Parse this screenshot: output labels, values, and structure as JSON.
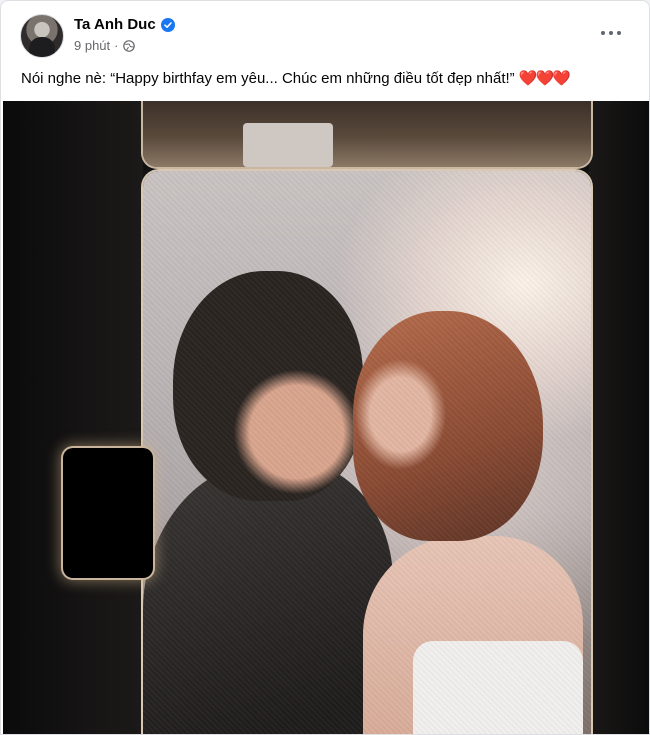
{
  "post": {
    "author_name": "Ta Anh Duc",
    "time": "9 phút",
    "separator": "·",
    "caption_text": "Nói nghe nè: “Happy birthfay em yêu... Chúc em những điều tốt đẹp nhất!”",
    "caption_emoji": "❤️❤️❤️"
  },
  "icons": {
    "verified": "verified-badge-icon",
    "audience": "globe-icon",
    "more": "more-options-icon"
  },
  "colors": {
    "verified": "#1877f2",
    "heart": "#e0245e",
    "muted_text": "#65676b"
  }
}
